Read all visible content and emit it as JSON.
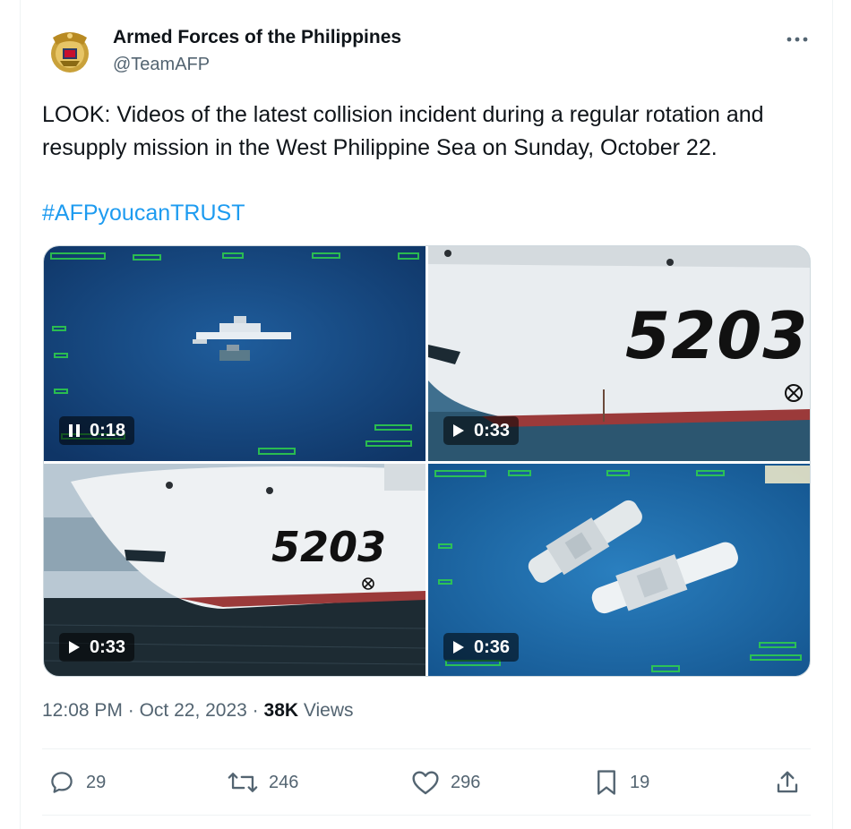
{
  "author": {
    "name": "Armed Forces of the Philippines",
    "handle": "@TeamAFP",
    "avatar_icon": "afp-seal-icon"
  },
  "tweet": {
    "text": "LOOK: Videos of the latest collision incident during a regular rotation and resupply mission in the West Philippine Sea on Sunday, October 22.",
    "hashtag": "#AFPyoucanTRUST"
  },
  "media": [
    {
      "duration": "0:18",
      "state": "playing",
      "icon": "pause-icon"
    },
    {
      "duration": "0:33",
      "state": "paused",
      "icon": "play-icon",
      "hull_number": "5203"
    },
    {
      "duration": "0:33",
      "state": "paused",
      "icon": "play-icon",
      "hull_number": "5203"
    },
    {
      "duration": "0:36",
      "state": "paused",
      "icon": "play-icon"
    }
  ],
  "meta": {
    "time": "12:08 PM",
    "sep1": "·",
    "date": "Oct 22, 2023",
    "sep2": "·",
    "views_count": "38K",
    "views_label": "Views"
  },
  "actions": {
    "replies": "29",
    "retweets": "246",
    "likes": "296",
    "bookmarks": "19"
  },
  "colors": {
    "link": "#1d9bf0",
    "secondary_text": "#536471",
    "primary_text": "#0f1419",
    "border": "#eff3f4"
  }
}
